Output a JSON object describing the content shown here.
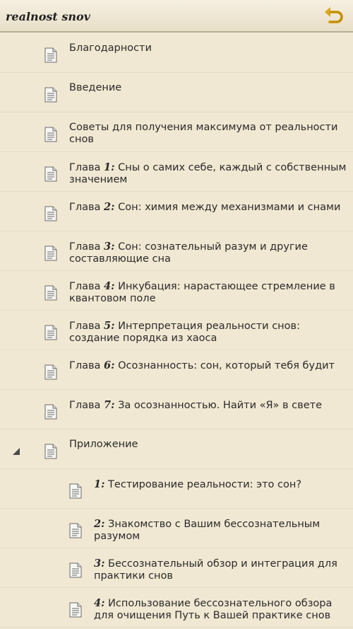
{
  "header": {
    "title": "realnost snov"
  },
  "items": [
    {
      "level": 1,
      "title": "Благодарности"
    },
    {
      "level": 1,
      "title": "Введение"
    },
    {
      "level": 1,
      "title": "Советы для получения максимума от реальности снов"
    },
    {
      "level": 1,
      "prefix": "Глава ",
      "num": "1:",
      "title": " Сны о самих себе, каждый с собственным значением"
    },
    {
      "level": 1,
      "prefix": "Глава ",
      "num": "2:",
      "title": " Сон: химия между механизмами и снами"
    },
    {
      "level": 1,
      "prefix": "Глава ",
      "num": "3:",
      "title": " Сон: сознательный разум и другие составляющие сна"
    },
    {
      "level": 1,
      "prefix": "Глава ",
      "num": "4:",
      "title": " Инкубация: нарастающее стремление в квантовом поле"
    },
    {
      "level": 1,
      "prefix": "Глава ",
      "num": "5:",
      "title": " Интерпретация реальности снов: создание порядка из хаоса"
    },
    {
      "level": 1,
      "prefix": "Глава ",
      "num": "6:",
      "title": " Осознанность: сон, который тебя будит"
    },
    {
      "level": 1,
      "prefix": "Глава ",
      "num": "7:",
      "title": " За осознанностью. Найти «Я» в свете"
    },
    {
      "level": 1,
      "title": "Приложение",
      "expanded": true
    },
    {
      "level": 2,
      "num": "1:",
      "title": " Тестирование реальности: это сон?"
    },
    {
      "level": 2,
      "num": "2:",
      "title": " Знакомство с Вашим бессознательным разумом"
    },
    {
      "level": 2,
      "num": "3:",
      "title": " Бессознательный обзор и интеграция для практики снов"
    },
    {
      "level": 2,
      "num": "4:",
      "title": " Использование бессознательного обзора для очищения Путь к Вашей практике снов"
    }
  ]
}
